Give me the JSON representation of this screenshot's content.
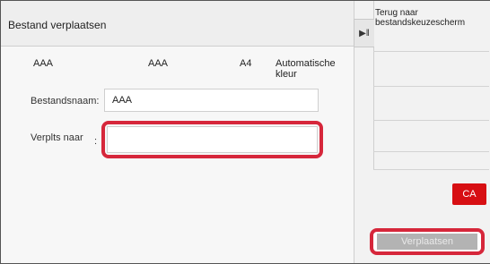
{
  "title": "Bestand verplaatsen",
  "properties": [
    "AAA",
    "AAA",
    "A4",
    "Automatische kleur"
  ],
  "filename": {
    "label": "Bestandsnaam:",
    "value": "AAA"
  },
  "destination": {
    "label": "Verplts naar",
    "colon": ":",
    "value": ""
  },
  "side": {
    "back_label": "Terug naar bestandskeuzescherm"
  },
  "buttons": {
    "ca": "CA",
    "move": "Verplaatsen"
  },
  "colors": {
    "highlight": "#d6273b",
    "ca": "#d70f13",
    "move_disabled": "#b3b3b3"
  }
}
